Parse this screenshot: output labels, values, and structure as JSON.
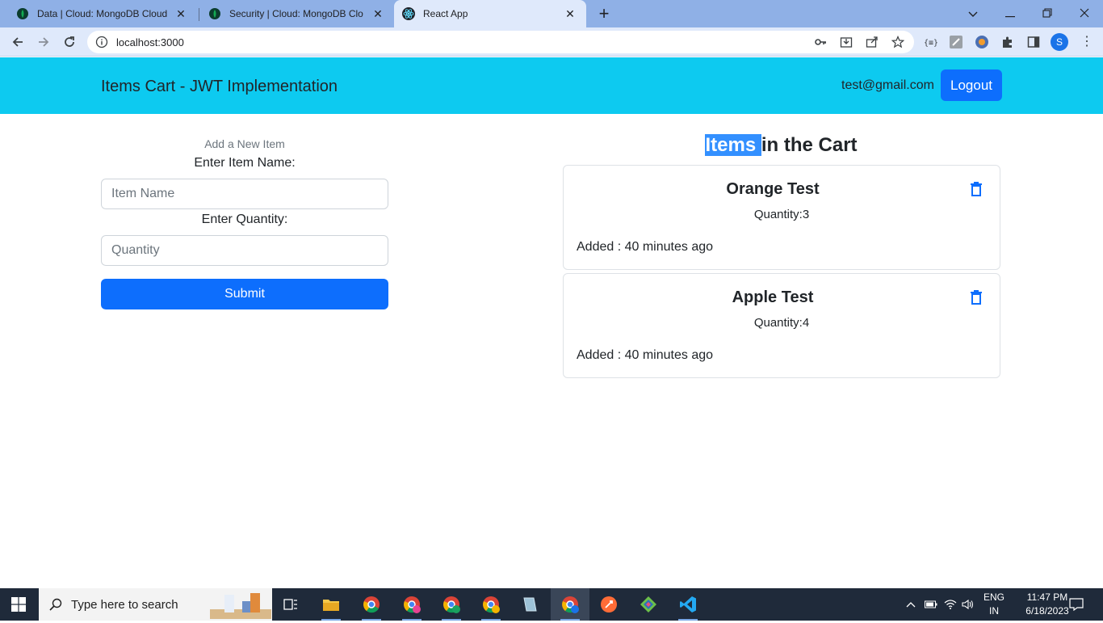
{
  "browser": {
    "tabs": [
      {
        "title": "Data | Cloud: MongoDB Cloud",
        "active": false
      },
      {
        "title": "Security | Cloud: MongoDB Cloud",
        "active": false
      },
      {
        "title": "React App",
        "active": true
      }
    ],
    "url": "localhost:3000",
    "profile_initial": "S"
  },
  "app": {
    "brand": "Items Cart - JWT Implementation",
    "user_email": "test@gmail.com",
    "logout_label": "Logout",
    "form": {
      "caption": "Add a New Item",
      "name_label": "Enter Item Name:",
      "name_placeholder": "Item Name",
      "qty_label": "Enter Quantity:",
      "qty_placeholder": "Quantity",
      "submit_label": "Submit"
    },
    "cart": {
      "title_highlight": "Items ",
      "title_rest": "in the Cart",
      "items": [
        {
          "name": "Orange Test",
          "quantity": "Quantity:3",
          "added": "Added : 40 minutes ago"
        },
        {
          "name": "Apple Test",
          "quantity": "Quantity:4",
          "added": "Added : 40 minutes ago"
        }
      ]
    }
  },
  "taskbar": {
    "search_placeholder": "Type here to search",
    "lang_top": "ENG",
    "lang_bottom": "IN",
    "time": "11:47 PM",
    "date": "6/18/2023"
  },
  "colors": {
    "navbar": "#0dcaf0",
    "primary": "#0d6efd",
    "highlight": "#3390ff"
  }
}
